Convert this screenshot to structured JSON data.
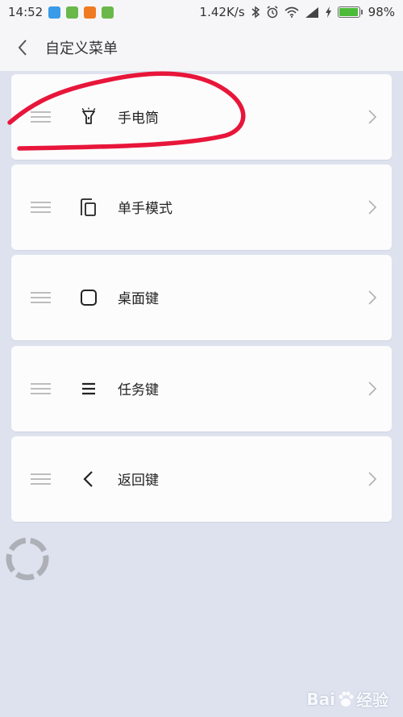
{
  "status_bar": {
    "time": "14:52",
    "network_speed": "1.42K/s",
    "battery_percent": "98%",
    "battery_level": 0.98,
    "app_icons": [
      {
        "name": "usb-icon",
        "color": "#3a9be8"
      },
      {
        "name": "storage-icon",
        "color": "#6ab84a"
      },
      {
        "name": "app-orange-icon",
        "color": "#f07a22"
      },
      {
        "name": "android-icon",
        "color": "#6ab84a"
      }
    ]
  },
  "header": {
    "title": "自定义菜单",
    "back_icon": "chevron-left-icon"
  },
  "menu_items": [
    {
      "label": "手电筒",
      "icon": "flashlight-icon"
    },
    {
      "label": "单手模式",
      "icon": "one-hand-mode-icon"
    },
    {
      "label": "桌面键",
      "icon": "home-key-icon"
    },
    {
      "label": "任务键",
      "icon": "task-key-icon"
    },
    {
      "label": "返回键",
      "icon": "back-key-icon"
    }
  ],
  "colors": {
    "background": "#dde2ee",
    "card": "#fcfcfd",
    "annotation_red": "#e8163a",
    "battery_green": "#4cbb3a"
  },
  "watermark": {
    "brand": "Bai",
    "brand_suffix": "经验",
    "icon": "baidu-paw-icon"
  }
}
